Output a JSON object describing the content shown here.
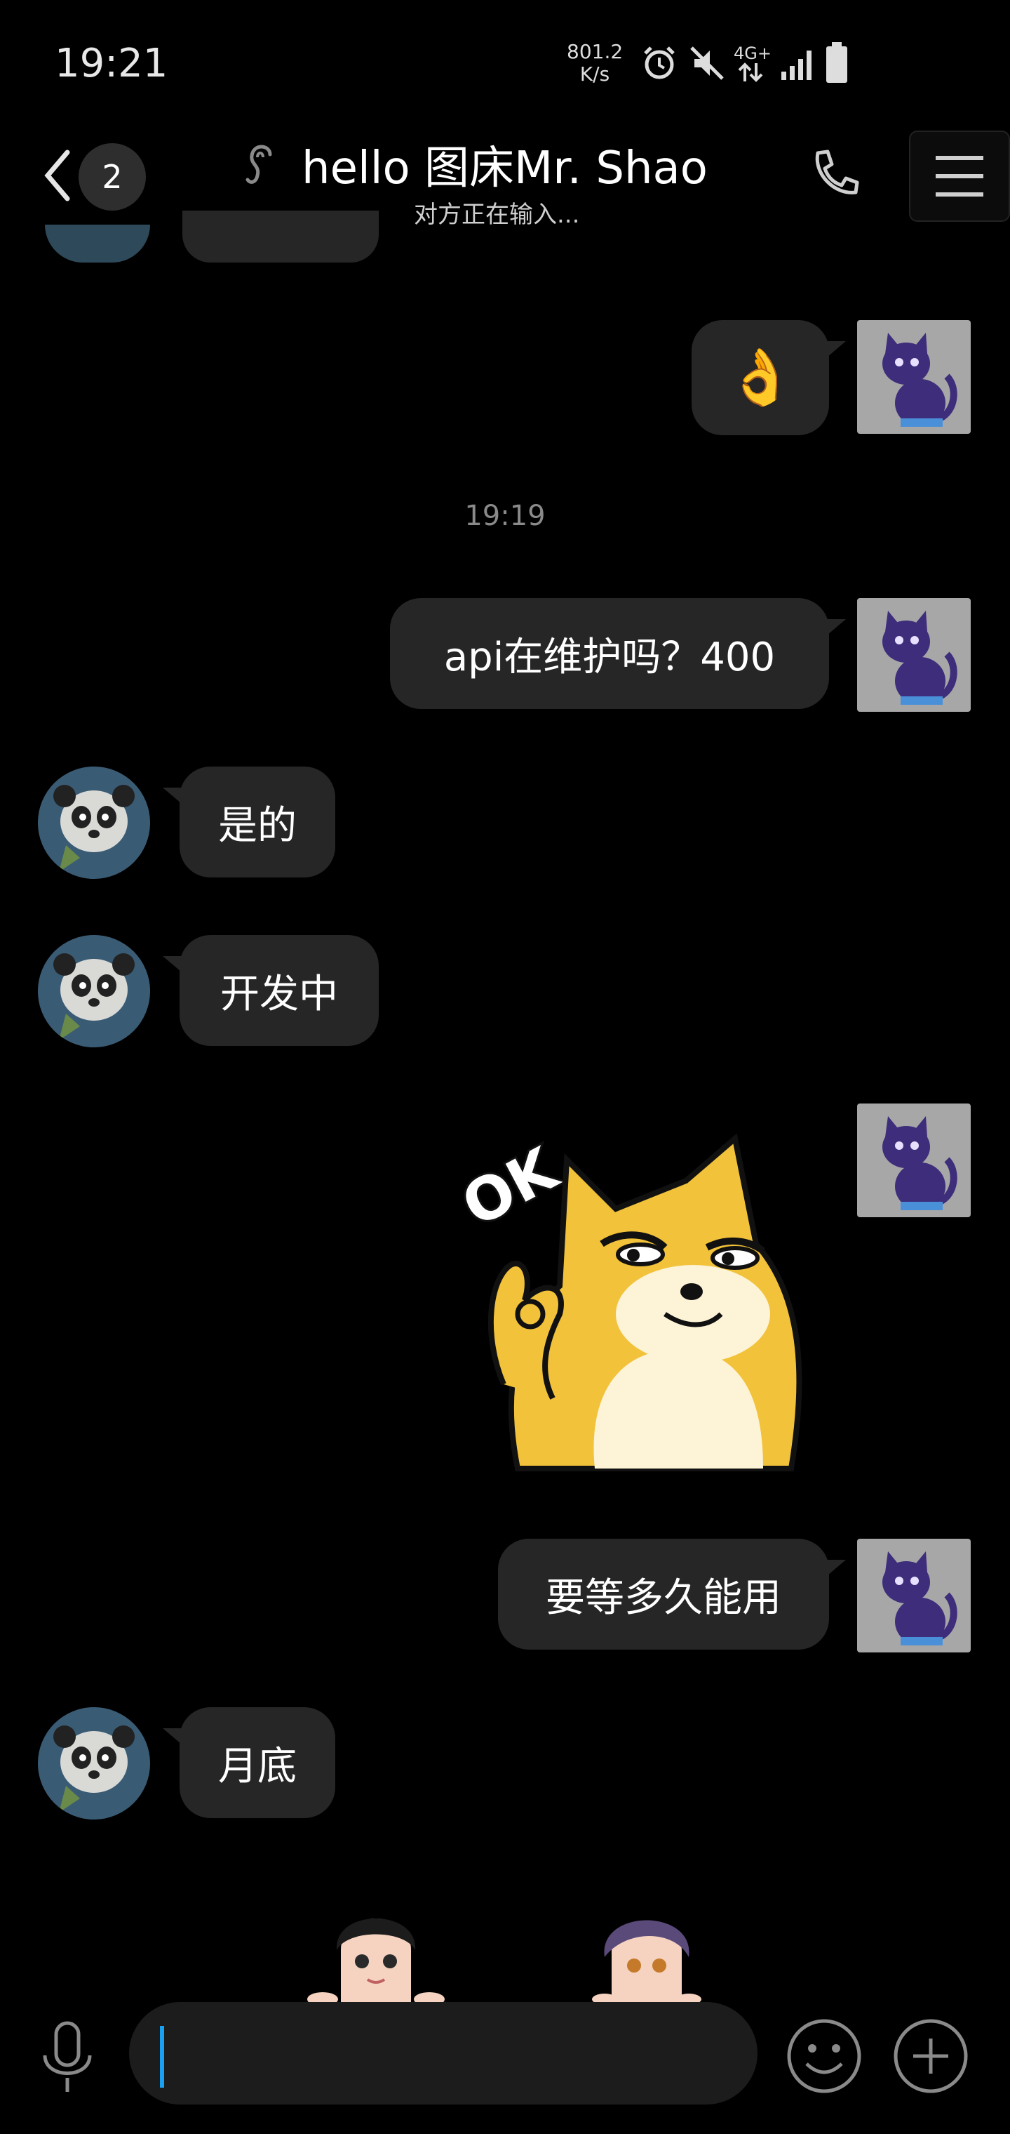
{
  "status_bar": {
    "time": "19:21",
    "net_speed_value": "801.2",
    "net_speed_unit": "K/s",
    "network": "4G+",
    "icons": [
      "alarm-icon",
      "mute-icon",
      "network-icon",
      "signal-icon",
      "battery-icon"
    ]
  },
  "header": {
    "unread_count": "2",
    "title": "hello 图床Mr. Shao",
    "subtitle": "对方正在输入..."
  },
  "messages": {
    "m1": "👌",
    "timestamp": "19:19",
    "m2": "api在维护吗？400",
    "m3": "是的",
    "m4": "开发中",
    "sticker_text": "OK",
    "m6": "要等多久能用",
    "m7": "月底"
  },
  "colors": {
    "background": "#000000",
    "bubble": "#262626",
    "caret": "#1aa0f0",
    "cat_avatar_bg": "#a7a7a8"
  }
}
